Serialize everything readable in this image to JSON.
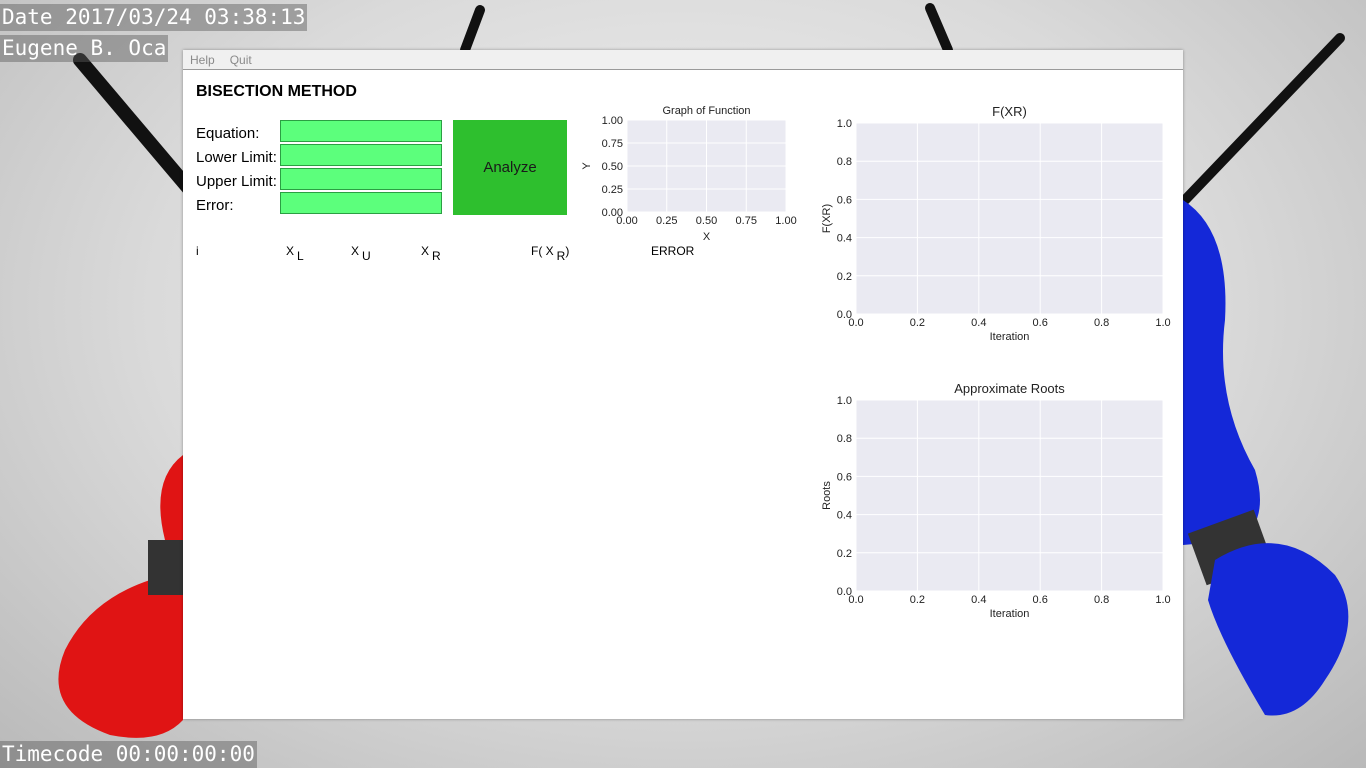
{
  "osd": {
    "date": "Date 2017/03/24 03:38:13",
    "author": "Eugene B. Oca",
    "timecode": "Timecode 00:00:00:00"
  },
  "menu": {
    "items": [
      "Help",
      "Quit"
    ]
  },
  "app": {
    "title": "BISECTION METHOD",
    "fields": [
      {
        "label": "Equation:",
        "value": "",
        "placeholder": ""
      },
      {
        "label": "Lower Limit:",
        "value": "",
        "placeholder": ""
      },
      {
        "label": "Upper Limit:",
        "value": "",
        "placeholder": ""
      },
      {
        "label": "Error:",
        "value": "",
        "placeholder": ""
      }
    ],
    "analyze_label": "Analyze",
    "columns": {
      "i": "i",
      "xl": {
        "base": "X",
        "sub": "L"
      },
      "xu": {
        "base": "X",
        "sub": "U"
      },
      "xr": {
        "base": "X",
        "sub": "R"
      },
      "fxr": {
        "prefix": "F( X",
        "sub": "R",
        "suffix": ")"
      },
      "error": "ERROR"
    }
  },
  "colors": {
    "input_bg": "#5cff7c",
    "button_bg": "#2ebf2e",
    "plot_bg": "#eaeaf2",
    "wallpaper_red": "#e01414",
    "wallpaper_blue": "#1428d8"
  },
  "chart_data": [
    {
      "id": "graph-of-function",
      "type": "line",
      "title": "Graph of Function",
      "xlabel": "X",
      "ylabel": "Y",
      "xlim": [
        0,
        1
      ],
      "ylim": [
        0,
        1
      ],
      "xticks": [
        "0.00",
        "0.25",
        "0.50",
        "0.75",
        "1.00"
      ],
      "yticks": [
        "0.00",
        "0.25",
        "0.50",
        "0.75",
        "1.00"
      ],
      "grid": true,
      "series": []
    },
    {
      "id": "fxr-chart",
      "type": "line",
      "title": "F(XR)",
      "xlabel": "Iteration",
      "ylabel": "F(XR)",
      "xlim": [
        0,
        1
      ],
      "ylim": [
        0,
        1
      ],
      "xticks": [
        "0.0",
        "0.2",
        "0.4",
        "0.6",
        "0.8",
        "1.0"
      ],
      "yticks": [
        "0.0",
        "0.2",
        "0.4",
        "0.6",
        "0.8",
        "1.0"
      ],
      "grid": true,
      "series": []
    },
    {
      "id": "approx-roots-chart",
      "type": "line",
      "title": "Approximate Roots",
      "xlabel": "Iteration",
      "ylabel": "Roots",
      "xlim": [
        0,
        1
      ],
      "ylim": [
        0,
        1
      ],
      "xticks": [
        "0.0",
        "0.2",
        "0.4",
        "0.6",
        "0.8",
        "1.0"
      ],
      "yticks": [
        "0.0",
        "0.2",
        "0.4",
        "0.6",
        "0.8",
        "1.0"
      ],
      "grid": true,
      "series": []
    }
  ]
}
